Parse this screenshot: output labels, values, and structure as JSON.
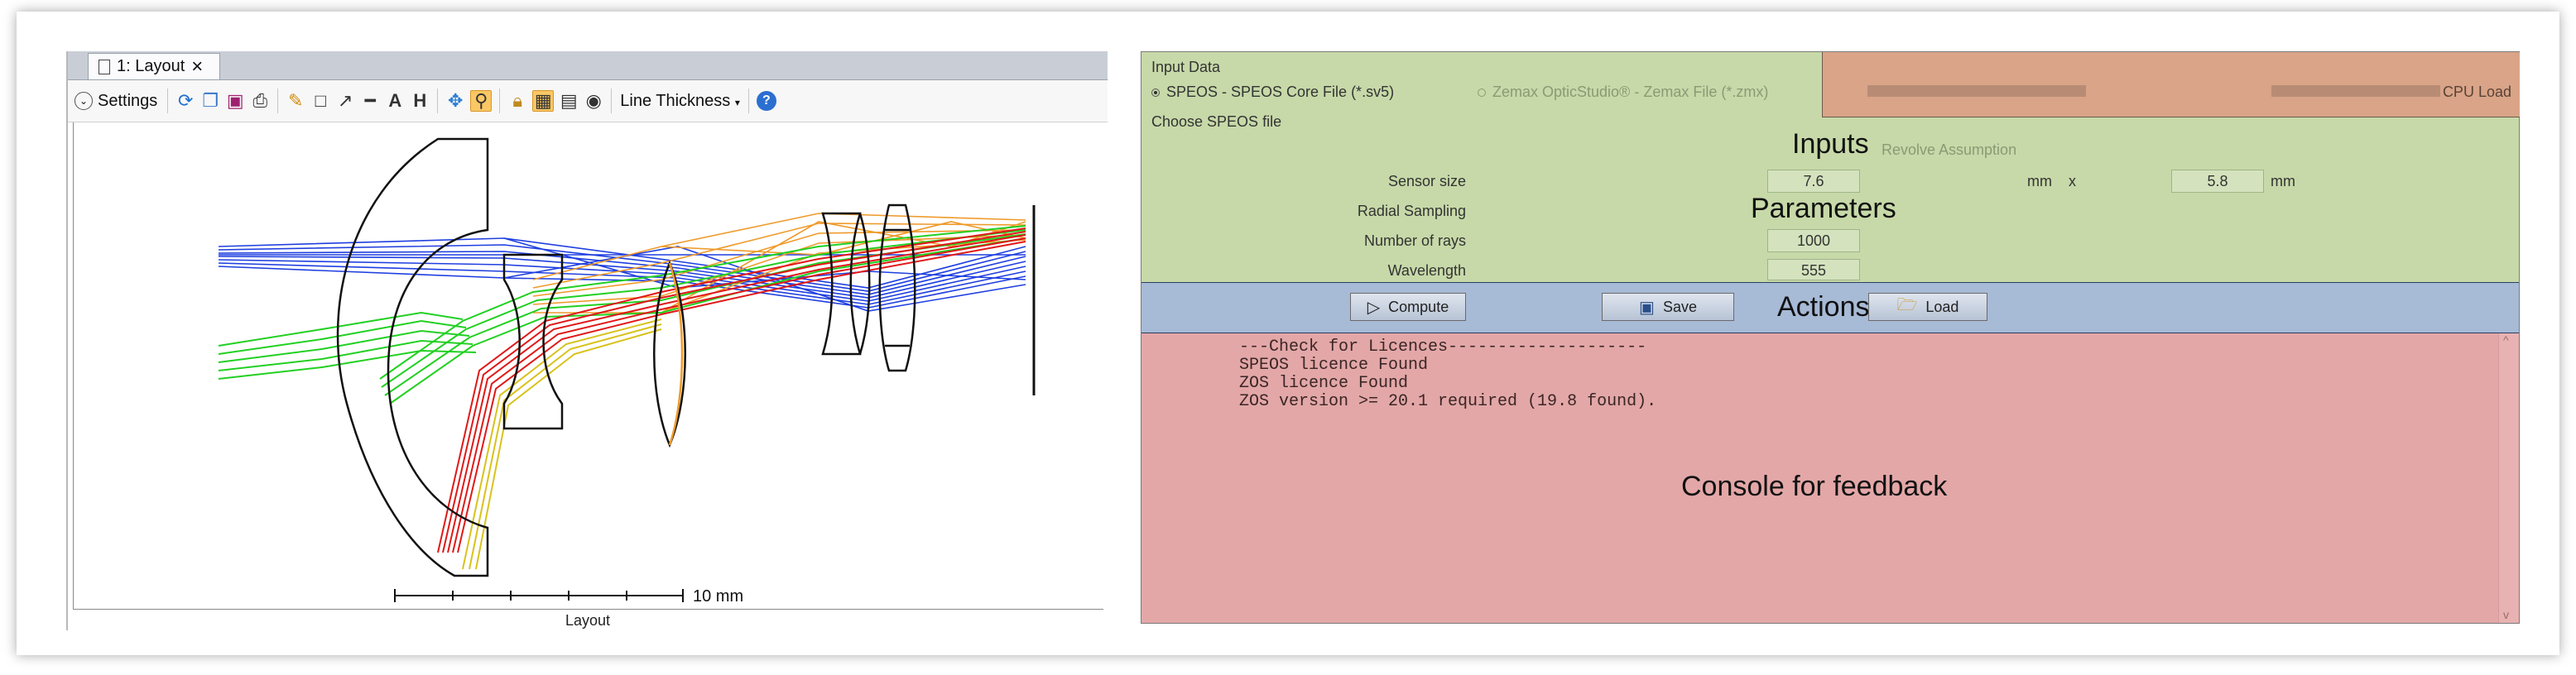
{
  "layout_window": {
    "tab_label": "1: Layout",
    "settings_label": "Settings",
    "line_thickness_label": "Line Thickness",
    "scale_label": "10 mm",
    "caption": "Layout"
  },
  "plugin": {
    "input_data_label": "Input Data",
    "option_speos": "SPEOS - SPEOS Core File (*.sv5)",
    "option_zemax": "Zemax OpticStudio® - Zemax File (*.zmx)",
    "choose_file_label": "Choose SPEOS file",
    "revolve_label": "Revolve Assumption",
    "cpu_load_label": "CPU Load",
    "zone_inputs": "Inputs",
    "zone_parameters": "Parameters",
    "zone_actions": "Actions",
    "zone_console": "Console for feedback",
    "params": {
      "sensor_size_label": "Sensor size",
      "sensor_width": "7.6",
      "sensor_unit": "mm",
      "x_label": "x",
      "sensor_height": "5.8",
      "sensor_unit2": "mm",
      "radial_label": "Radial Sampling",
      "rays_label": "Number of rays",
      "rays_value": "1000",
      "wavelength_label": "Wavelength",
      "wavelength_value": "555"
    },
    "buttons": {
      "compute": "Compute",
      "save": "Save",
      "load": "Load"
    },
    "console": [
      "---Check for Licences--------------------",
      "SPEOS licence Found",
      "ZOS licence Found",
      "ZOS version >= 20.1 required (19.8 found)."
    ]
  },
  "colors": {
    "inputs_zone": "#c7d9a8",
    "cpu_zone": "#d9a488",
    "actions_zone": "#a7bad6",
    "console_zone": "#e3a7a7",
    "ray_blue": "#1f3fe0",
    "ray_green": "#22d022",
    "ray_red": "#e01818",
    "ray_yellow": "#d8c21c",
    "ray_orange": "#ef9a2a"
  }
}
